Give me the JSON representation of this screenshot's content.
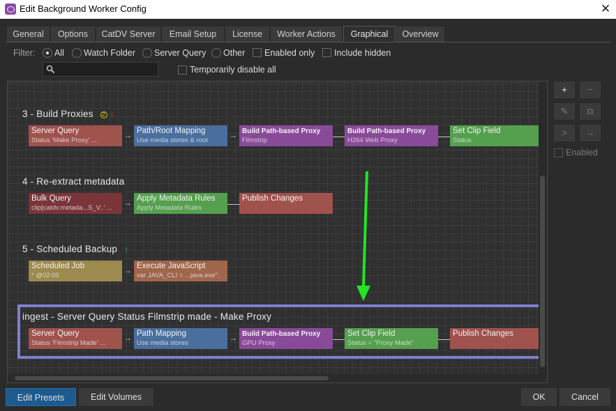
{
  "window": {
    "title": "Edit Background Worker Config",
    "close_icon": "close-icon"
  },
  "tabs": [
    {
      "label": "General",
      "active": false
    },
    {
      "label": "Options",
      "active": false
    },
    {
      "label": "CatDV Server",
      "active": false
    },
    {
      "label": "Email Setup",
      "active": false
    },
    {
      "label": "License",
      "active": false
    },
    {
      "label": "Worker Actions",
      "active": false
    },
    {
      "label": "Graphical",
      "active": true
    },
    {
      "label": "Overview",
      "active": false
    }
  ],
  "filter": {
    "label": "Filter:",
    "options": [
      {
        "label": "All",
        "selected": true
      },
      {
        "label": "Watch Folder",
        "selected": false
      },
      {
        "label": "Server Query",
        "selected": false
      },
      {
        "label": "Other",
        "selected": false
      }
    ],
    "enabled_only": {
      "label": "Enabled only",
      "checked": false
    },
    "include_hidden": {
      "label": "Include hidden",
      "checked": false
    },
    "search": {
      "value": "",
      "placeholder": "",
      "icon": "search-icon"
    },
    "temporarily_disable_all": {
      "label": "Temporarily disable all",
      "checked": false
    }
  },
  "workflows": [
    {
      "title": "3 - Build Proxies",
      "badge_number": "2",
      "priority": "↓",
      "priority_color": "#e03030",
      "nodes": [
        {
          "title": "Server Query",
          "subtitle": "Status 'Make Proxy' ...",
          "color": "#a0524d"
        },
        {
          "title": "Path/Root Mapping",
          "subtitle": "Use media stores & root",
          "color": "#4a6f9e"
        },
        {
          "title": "Build Path-based Proxy",
          "subtitle": "Filmstrip",
          "color": "#8a4a9a"
        },
        {
          "title": "Build Path-based Proxy",
          "subtitle": "H264 Web Proxy",
          "color": "#8a4a9a"
        },
        {
          "title": "Set Clip Field",
          "subtitle": "Status",
          "color": "#55a04e"
        }
      ]
    },
    {
      "title": "4 - Re-extract metadata",
      "nodes": [
        {
          "title": "Bulk Query",
          "subtitle": "clip[catdv.metada...S_V..' ...",
          "color": "#7a3538"
        },
        {
          "title": "Apply Metadata Rules",
          "subtitle": "Apply Metadata Rules",
          "color": "#55a04e"
        },
        {
          "title": "Publish Changes",
          "subtitle": "",
          "color": "#a0524d"
        }
      ]
    },
    {
      "title": "5 - Scheduled Backup",
      "priority": "↑",
      "priority_color": "#22c022",
      "nodes": [
        {
          "title": "Scheduled Job",
          "subtitle": "* @02:00",
          "color": "#9c8a4e"
        },
        {
          "title": "Execute JavaScript",
          "subtitle": "var JAVA_CLI = ...java.exe\";",
          "color": "#a0654a"
        }
      ]
    },
    {
      "title": "ingest - Server Query Status Filmstrip made - Make Proxy",
      "highlighted": true,
      "nodes": [
        {
          "title": "Server Query",
          "subtitle": "Status 'Filmstrip Made' ...",
          "color": "#a0524d"
        },
        {
          "title": "Path Mapping",
          "subtitle": "Use media stores",
          "color": "#4a6f9e"
        },
        {
          "title": "Build Path-based Proxy",
          "subtitle": "GPU Proxy",
          "color": "#8a4a9a"
        },
        {
          "title": "Set Clip Field",
          "subtitle": "Status = \"Proxy Made\"",
          "color": "#55a04e"
        },
        {
          "title": "Publish Changes",
          "subtitle": "",
          "color": "#a0524d"
        }
      ]
    }
  ],
  "annotation": {
    "type": "arrow",
    "color": "#22e622",
    "direction": "down"
  },
  "side_panel": {
    "buttons": [
      {
        "icon": "plus-icon",
        "glyph": "+"
      },
      {
        "icon": "minus-icon",
        "glyph": "−"
      },
      {
        "icon": "pencil-icon",
        "glyph": "✎"
      },
      {
        "icon": "duplicate-icon",
        "glyph": "⧉"
      },
      {
        "icon": "split-icon",
        "glyph": ">"
      },
      {
        "icon": "connect-icon",
        "glyph": "→"
      }
    ],
    "enabled": {
      "label": "Enabled",
      "checked": false
    }
  },
  "footer": {
    "edit_presets": "Edit Presets",
    "edit_volumes": "Edit Volumes",
    "ok": "OK",
    "cancel": "Cancel"
  }
}
